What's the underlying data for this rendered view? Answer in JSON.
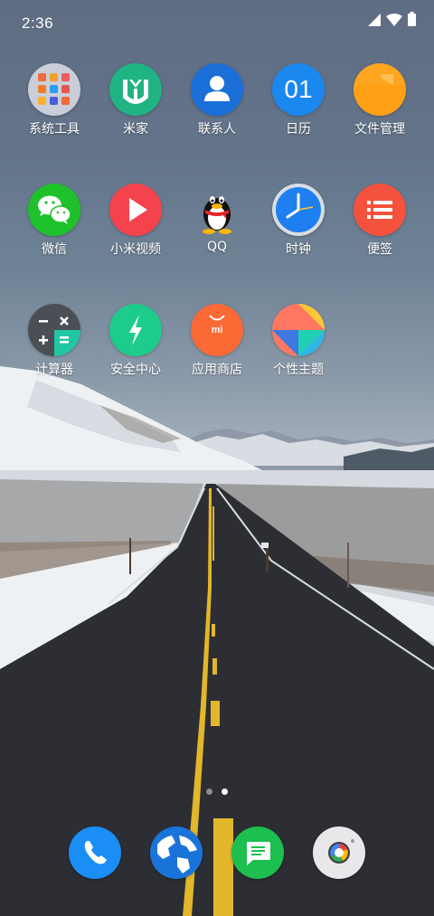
{
  "status_bar": {
    "time": "2:36",
    "icons": [
      "signal-icon",
      "wifi-icon",
      "battery-icon"
    ]
  },
  "home": {
    "rows": [
      [
        {
          "label": "系统工具",
          "icon": "system-tools-folder-icon",
          "color": "#cfd4dc"
        },
        {
          "label": "米家",
          "icon": "mijia-icon",
          "color": "#20b383"
        },
        {
          "label": "联系人",
          "icon": "contacts-icon",
          "color": "#1a6fd8"
        },
        {
          "label": "日历",
          "icon": "calendar-icon",
          "color": "#1b88f0",
          "icon_text": "01"
        },
        {
          "label": "文件管理",
          "icon": "file-manager-icon",
          "color": "#ffa51f"
        }
      ],
      [
        {
          "label": "微信",
          "icon": "wechat-icon",
          "color": "#1fc12b"
        },
        {
          "label": "小米视频",
          "icon": "mi-video-icon",
          "color": "#f5434d"
        },
        {
          "label": "QQ",
          "icon": "qq-penguin-icon",
          "color": "#000000"
        },
        {
          "label": "时钟",
          "icon": "clock-icon",
          "color": "#1e7ff0"
        },
        {
          "label": "便签",
          "icon": "notes-icon",
          "color": "#f4523c"
        }
      ],
      [
        {
          "label": "计算器",
          "icon": "calculator-icon",
          "color": "#4b4f55"
        },
        {
          "label": "安全中心",
          "icon": "security-center-icon",
          "color": "#1dcc8b"
        },
        {
          "label": "应用商店",
          "icon": "app-store-icon",
          "color": "#fb6935",
          "icon_text": "mi"
        },
        {
          "label": "个性主题",
          "icon": "themes-icon",
          "color": "#ff7761"
        }
      ]
    ]
  },
  "page_indicator": {
    "pages": 2,
    "current": 2
  },
  "dock": [
    {
      "icon": "phone-icon",
      "color": "#1a8ef5"
    },
    {
      "icon": "browser-globe-icon",
      "color": "#1a73d9"
    },
    {
      "icon": "messages-icon",
      "color": "#1dbf4f"
    },
    {
      "icon": "camera-icon",
      "color": "#e8e8ea"
    }
  ]
}
